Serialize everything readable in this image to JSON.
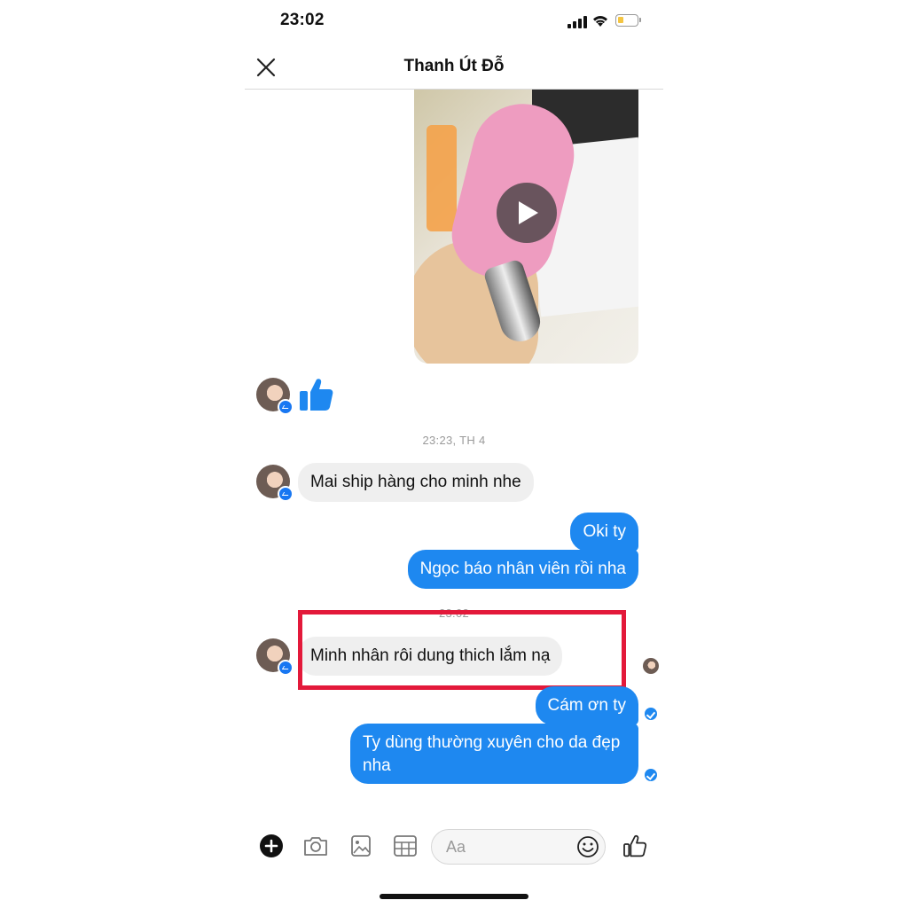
{
  "status_bar": {
    "time": "23:02"
  },
  "header": {
    "title": "Thanh Út Đỗ"
  },
  "messages": {
    "timestamp_1": "23:23, TH 4",
    "timestamp_2": "23:02",
    "in_1": "Mai ship hàng cho minh nhe",
    "out_1": "Oki ty",
    "out_2": "Ngọc báo nhân viên rồi nha",
    "in_2": "Minh nhân rôi dung thich lắm nạ",
    "out_3": "Cám ơn ty",
    "out_4_line1": "Ty dùng thường xuyên cho da đẹp",
    "out_4_line2": "nha"
  },
  "composer": {
    "placeholder": "Aa"
  },
  "icons": {
    "close": "close-icon",
    "play": "play-icon",
    "like": "thumbs-up-icon",
    "plus": "plus-icon",
    "camera": "camera-icon",
    "image": "image-icon",
    "gif": "gif-icon",
    "emoji": "emoji-icon",
    "seen": "seen-check-icon"
  },
  "colors": {
    "accent": "#1e88f0",
    "incoming_bg": "#efefef",
    "highlight": "#e3193a"
  }
}
